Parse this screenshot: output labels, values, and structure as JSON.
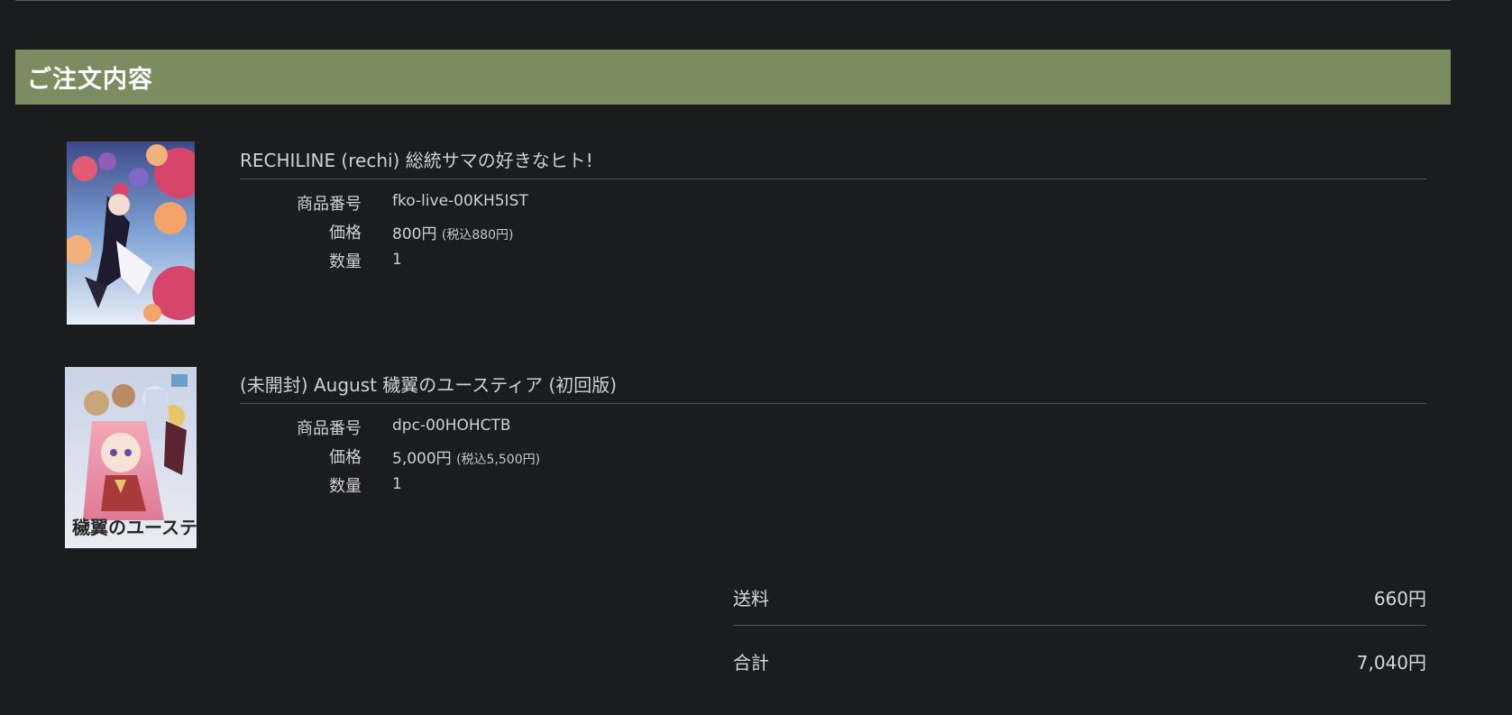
{
  "section": {
    "title": "ご注文内容"
  },
  "items": [
    {
      "title": "RECHILINE (rechi) 総統サマの好きなヒト!",
      "specs": {
        "code_label": "商品番号",
        "code": "fko-live-00KH5IST",
        "price_label": "価格",
        "price": "800円",
        "price_tax": "(税込880円)",
        "qty_label": "数量",
        "qty": "1"
      }
    },
    {
      "title": "(未開封) August 穢翼のユースティア (初回版)",
      "specs": {
        "code_label": "商品番号",
        "code": "dpc-00HOHCTB",
        "price_label": "価格",
        "price": "5,000円",
        "price_tax": "(税込5,500円)",
        "qty_label": "数量",
        "qty": "1"
      },
      "cover_logo_text": "穢翼のユースティア"
    }
  ],
  "summary": {
    "shipping_label": "送料",
    "shipping_value": "660円",
    "total_label": "合計",
    "total_value": "7,040円"
  }
}
